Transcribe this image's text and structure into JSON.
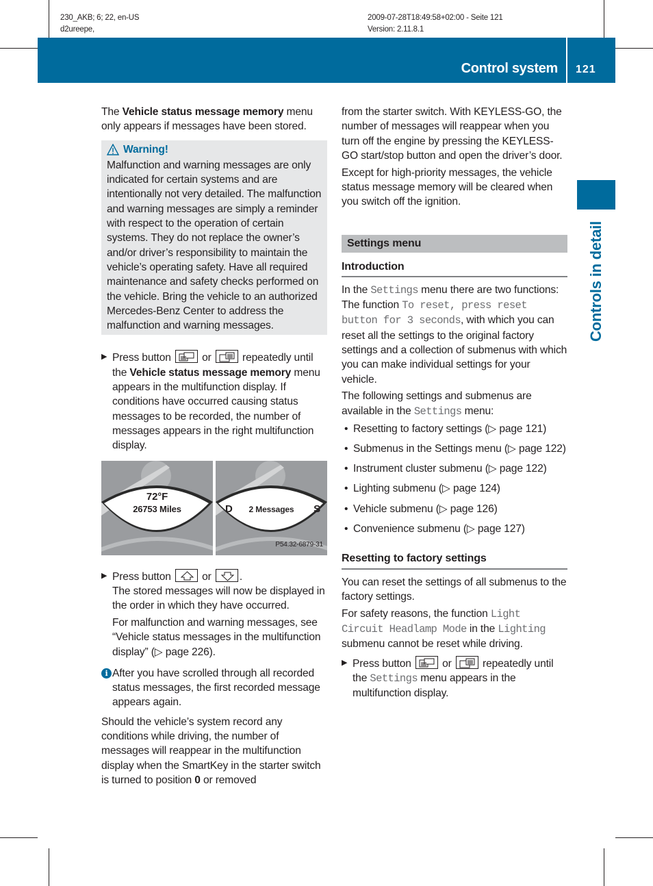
{
  "meta": {
    "left_line1": "230_AKB; 6; 22, en-US",
    "left_line2": "d2ureepe,",
    "right_line1": "2009-07-28T18:49:58+02:00 - Seite 121",
    "right_line2": "Version: 2.11.8.1"
  },
  "header": {
    "title": "Control system",
    "page_number": "121",
    "band_color": "#006b9d"
  },
  "side_tab": {
    "label": "Controls in detail"
  },
  "left": {
    "intro": {
      "pre": "The ",
      "bold": "Vehicle status message memory",
      "post": " menu only appears if messages have been stored."
    },
    "warning": {
      "icon": "warning-triangle-icon",
      "title": "Warning!",
      "body": "Malfunction and warning messages are only indicated for certain systems and are intentionally not very detailed. The malfunction and warning messages are simply a reminder with respect to the operation of certain systems. They do not replace the owner’s and/or driver’s responsibility to maintain the vehicle’s operating safety. Have all required maintenance and safety checks performed on the vehicle. Bring the vehicle to an authorized Mercedes-Benz Center to address the malfunction and warning messages."
    },
    "step1": {
      "pre": "Press button ",
      "icon_a": "display-prev-button-icon",
      "mid": " or ",
      "icon_b": "display-next-button-icon",
      "post1": " repeatedly until the ",
      "bold": "Vehicle status message memory",
      "post2": " menu appears in the multifunction display. If conditions have occurred causing status messages to be recorded, the number of messages appears in the right multifunction display."
    },
    "figure": {
      "left_temp": "72°F",
      "left_odometer": "26753 Miles",
      "right_left_letter": "D",
      "right_message": "2 Messages",
      "right_right_letter": "S",
      "code": "P54.32-6879-31"
    },
    "step2": {
      "pre": "Press button ",
      "icon_a": "arrow-up-button-icon",
      "mid": " or ",
      "icon_b": "arrow-down-button-icon",
      "post": ".",
      "para1": "The stored messages will now be displayed in the order in which they have occurred.",
      "para2": "For malfunction and warning messages, see “Vehicle status messages in the multifunction display” (▷ page 226)."
    },
    "info": {
      "icon": "info-icon",
      "text": "After you have scrolled through all recorded status messages, the first recorded message appears again."
    },
    "closing": {
      "pre": "Should the vehicle’s system record any conditions while driving, the number of messages will reappear in the multifunction display when the SmartKey in the starter switch is turned to position ",
      "bold": "0",
      "post": " or removed"
    }
  },
  "right": {
    "cont1": "from the starter switch. With KEYLESS-GO, the number of messages will reappear when you turn off the engine by pressing the KEYLESS-GO start/stop button and open the driver’s door.",
    "cont2": "Except for high-priority messages, the vehicle status message memory will be cleared when you switch off the ignition.",
    "section_title": "Settings menu",
    "intro_heading": "Introduction",
    "intro": {
      "t1": "In the ",
      "m1": "Settings",
      "t2": " menu there are two functions: The function ",
      "m2": "To reset, press reset button for 3 seconds",
      "t3": ", with which you can reset all the settings to the original factory settings and a collection of submenus with which you can make individual settings for your vehicle."
    },
    "available": {
      "t1": "The following settings and submenus are available in the ",
      "m1": "Settings",
      "t2": " menu:"
    },
    "bullets": [
      "Resetting to factory settings (▷ page 121)",
      "Submenus in the Settings menu (▷ page 122)",
      "Instrument cluster submenu (▷ page 122)",
      "Lighting submenu (▷ page 124)",
      "Vehicle submenu (▷ page 126)",
      "Convenience submenu (▷ page 127)"
    ],
    "reset_heading": "Resetting to factory settings",
    "reset_p1": "You can reset the settings of all submenus to the factory settings.",
    "reset_p2": {
      "t1": "For safety reasons, the function ",
      "m1": "Light Circuit Headlamp Mode",
      "t2": " in the ",
      "m2": "Lighting",
      "t3": " submenu cannot be reset while driving."
    },
    "reset_step": {
      "pre": "Press button ",
      "mid": " or ",
      "post1": " repeatedly until the ",
      "mono": "Settings",
      "post2": " menu appears in the multifunction display."
    }
  }
}
